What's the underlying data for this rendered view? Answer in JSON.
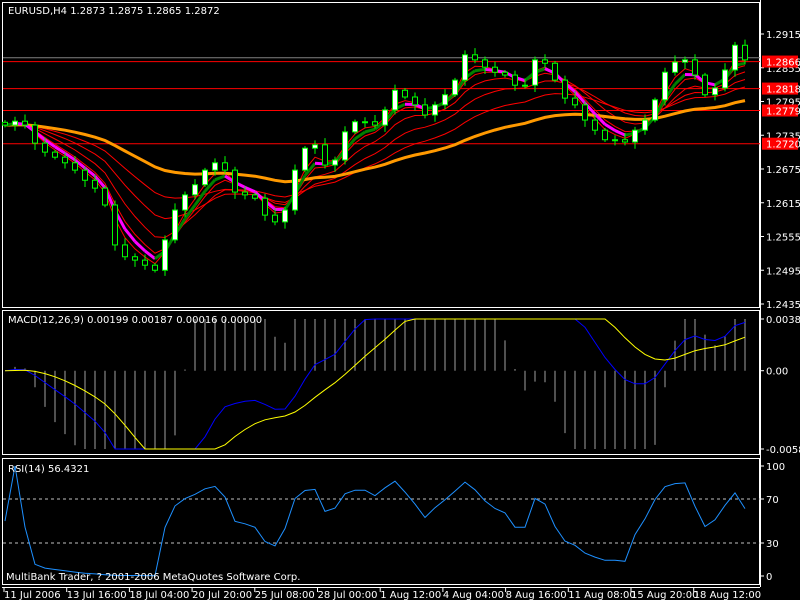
{
  "chart_data": [
    {
      "type": "candlestick",
      "title": "EURUSD,H4  1.2873 1.2875 1.2865 1.2872",
      "symbol": "EURUSD",
      "timeframe": "H4",
      "ylim": [
        1.2435,
        1.2915
      ],
      "y_ticks": [
        "1.2915",
        "1.2855",
        "1.2795",
        "1.2735",
        "1.2675",
        "1.2615",
        "1.2555",
        "1.2495",
        "1.2435"
      ],
      "current_price": "1.2872",
      "levels": [
        {
          "label": "1.2866",
          "value": 1.2866
        },
        {
          "label": "1.2818",
          "value": 1.2818
        },
        {
          "label": "1.2779",
          "value": 1.2779
        },
        {
          "label": "1.2720",
          "value": 1.272
        }
      ],
      "closes": [
        1.2753,
        1.276,
        1.2753,
        1.2721,
        1.2705,
        1.2696,
        1.2686,
        1.2673,
        1.2655,
        1.2641,
        1.2611,
        1.254,
        1.2519,
        1.2513,
        1.2504,
        1.2495,
        1.2549,
        1.2602,
        1.2629,
        1.2647,
        1.2673,
        1.2686,
        1.2673,
        1.2634,
        1.2629,
        1.2623,
        1.2593,
        1.2581,
        1.2602,
        1.2673,
        1.2712,
        1.2718,
        1.2682,
        1.2691,
        1.2741,
        1.2759,
        1.2759,
        1.2753,
        1.278,
        1.2815,
        1.2803,
        1.2789,
        1.2771,
        1.2789,
        1.2807,
        1.2833,
        1.2878,
        1.2869,
        1.2856,
        1.2847,
        1.2842,
        1.2824,
        1.2824,
        1.2869,
        1.2863,
        1.2833,
        1.2801,
        1.2789,
        1.2762,
        1.2744,
        1.2727,
        1.2727,
        1.2723,
        1.2744,
        1.2762,
        1.2798,
        1.2847,
        1.2865,
        1.2869,
        1.2842,
        1.2807,
        1.2819,
        1.2851,
        1.2895,
        1.2869
      ],
      "x_tick_labels": [
        "11 Jul 2006",
        "13 Jul 16:00",
        "18 Jul 04:00",
        "20 Jul 20:00",
        "25 Jul 08:00",
        "28 Jul 00:00",
        "1 Aug 12:00",
        "4 Aug 04:00",
        "8 Aug 16:00",
        "11 Aug 08:00",
        "15 Aug 20:00",
        "18 Aug 12:00"
      ],
      "colors": {
        "bull": "#00ff00",
        "bear": "#00ff00",
        "ma": "#ff0000",
        "slow_ma": "#ff9900",
        "level": "#ff0000",
        "up_trend_line": "#008000",
        "down_trend_line": "#ff00ff"
      }
    },
    {
      "type": "line",
      "title": "MACD(12,26,9) 0.00199 0.00187 0.00016 0.00000",
      "ylim": [
        -0.00583,
        0.00385
      ],
      "y_ticks": [
        "0.00385",
        "0.00",
        "-0.00583"
      ],
      "colors": {
        "macd": "#0000ff",
        "signal": "#ffff00",
        "histogram": "#a0a0a0"
      }
    },
    {
      "type": "line",
      "title": "RSI(14) 56.4321",
      "ylim": [
        0,
        100
      ],
      "y_ticks": [
        "100",
        "70",
        "30",
        "0"
      ],
      "levels": [
        70,
        30
      ],
      "colors": {
        "rsi": "#1e90ff"
      }
    }
  ],
  "footer": "MultiBank Trader, ? 2001-2006 MetaQuotes Software Corp."
}
